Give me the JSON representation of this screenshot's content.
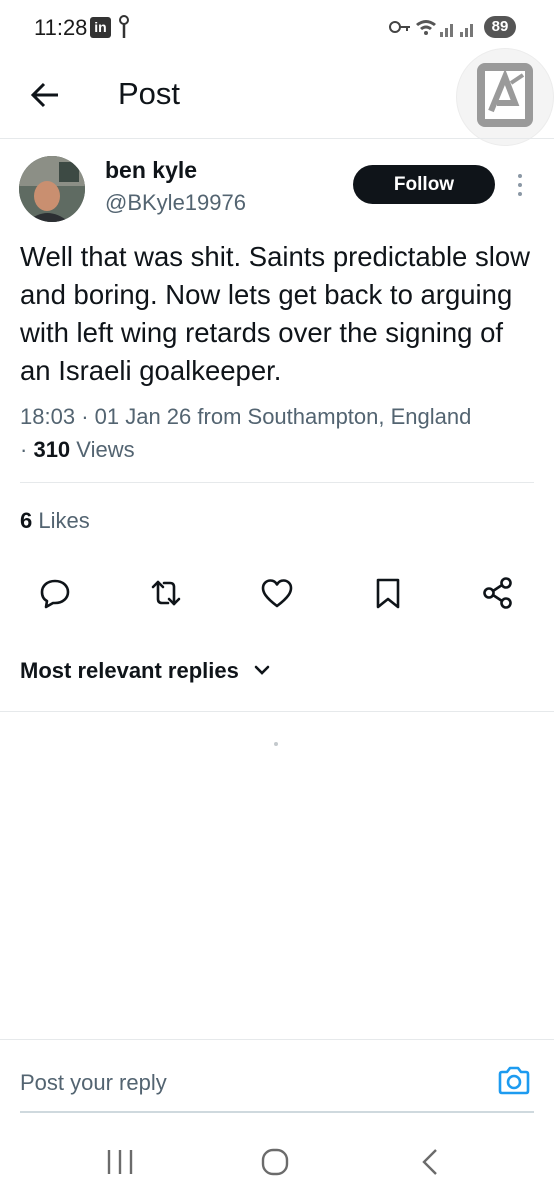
{
  "status_bar": {
    "time": "11:28",
    "notification_app": "in",
    "battery": "89"
  },
  "header": {
    "title": "Post"
  },
  "author": {
    "name": "ben kyle",
    "handle": "@BKyle19976"
  },
  "follow_label": "Follow",
  "post": {
    "text": "Well that was shit. Saints predictable slow and boring. Now lets get back to arguing with left wing retards over the signing of an Israeli goalkeeper.",
    "time": "18:03",
    "date": "01 Jan 26",
    "location": "from Southampton, England",
    "views_count": "310",
    "views_label": "Views",
    "likes_count": "6",
    "likes_label": "Likes"
  },
  "actions": [
    "reply-icon",
    "repost-icon",
    "like-icon",
    "bookmark-icon",
    "share-icon"
  ],
  "replies_filter": {
    "label": "Most relevant replies"
  },
  "reply_bar": {
    "placeholder": "Post your reply"
  },
  "colors": {
    "text_primary": "#0f1419",
    "text_secondary": "#536471",
    "accent": "#1d9bf0",
    "follow_bg": "#0f1419"
  }
}
